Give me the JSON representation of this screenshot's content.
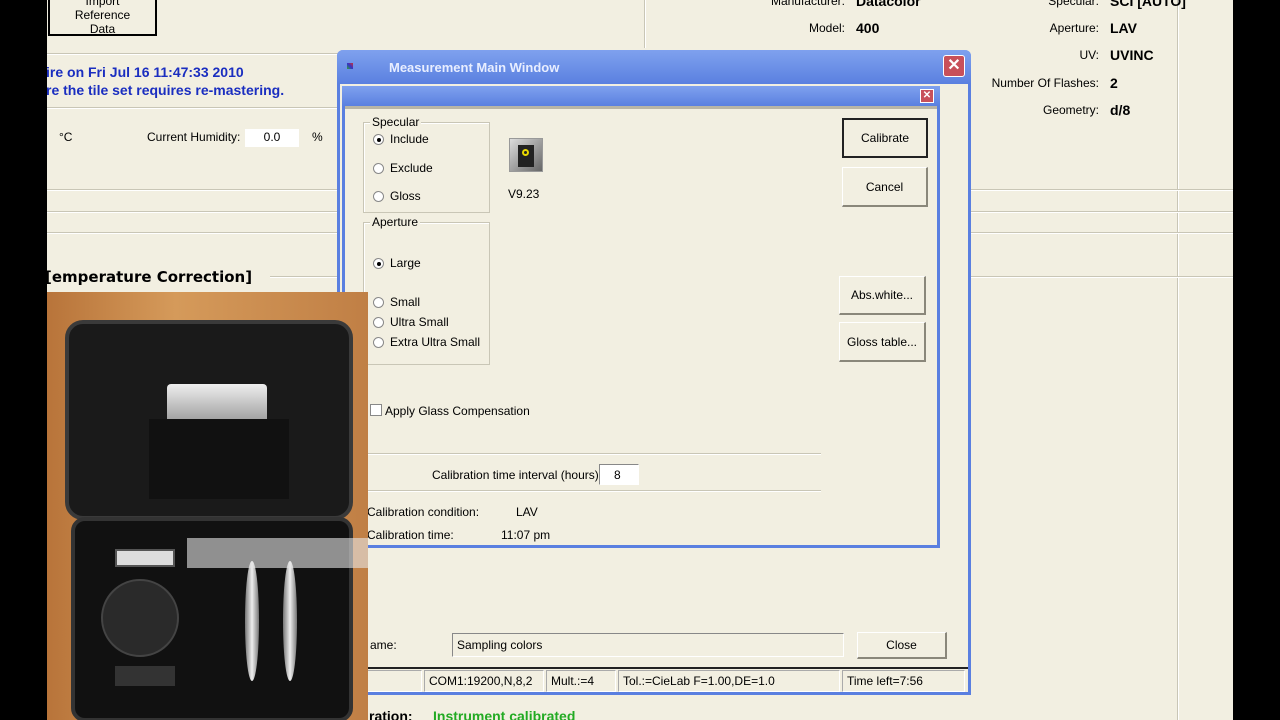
{
  "background": {
    "import_button": "Import Reference Data",
    "notice_line1": "ire on Fri Jul 16 11:47:33 2010",
    "notice_line2": "re the tile set requires re-mastering.",
    "temp_unit": "°C",
    "humidity_label": "Current Humidity:",
    "humidity_value": "0.0",
    "humidity_unit": "%",
    "section_title": "[emperature Correction]",
    "calibration_label": "ration:",
    "calibration_status": "Instrument calibrated",
    "calibration_status_color": "#22aa22",
    "info": [
      {
        "label": "Manufacturer:",
        "value": "Datacolor"
      },
      {
        "label": "Model:",
        "value": "400"
      }
    ],
    "info_right": [
      {
        "label": "Specular:",
        "value": "SCI [AUTO]"
      },
      {
        "label": "Aperture:",
        "value": "LAV"
      },
      {
        "label": "UV:",
        "value": "UVINC"
      },
      {
        "label": "Number Of Flashes:",
        "value": "2"
      },
      {
        "label": "Geometry:",
        "value": "d/8"
      }
    ]
  },
  "main_window": {
    "title": "Measurement Main Window",
    "name_label": "ame:",
    "name_value": "Sampling colors",
    "close_button": "Close",
    "status": [
      "COM1:19200,N,8,2",
      "Mult.:=4",
      "Tol.:=CieLab F=1.00,DE=1.0",
      "Time left=7:56"
    ]
  },
  "calibration_dialog": {
    "specular_title": "Specular",
    "specular_options": [
      "Include",
      "Exclude",
      "Gloss"
    ],
    "specular_selected": "Include",
    "aperture_title": "Aperture",
    "aperture_options": [
      "Large",
      "Small",
      "Ultra Small",
      "Extra Ultra Small"
    ],
    "aperture_selected": "Large",
    "version": "V9.23",
    "calibrate_button": "Calibrate",
    "cancel_button": "Cancel",
    "abs_white_button": "Abs.white...",
    "gloss_table_button": "Gloss table...",
    "glass_compensation_label": "Apply Glass Compensation",
    "glass_compensation_checked": false,
    "interval_label": "Calibration time interval (hours):",
    "interval_value": "8",
    "condition_label": "Calibration condition:",
    "condition_value": "LAV",
    "time_label": "Calibration time:",
    "time_value": "11:07 pm"
  },
  "colors": {
    "titlebar": "#6b8fe0",
    "accent_text": "#1a2ec0",
    "close_red": "#c8505a"
  }
}
